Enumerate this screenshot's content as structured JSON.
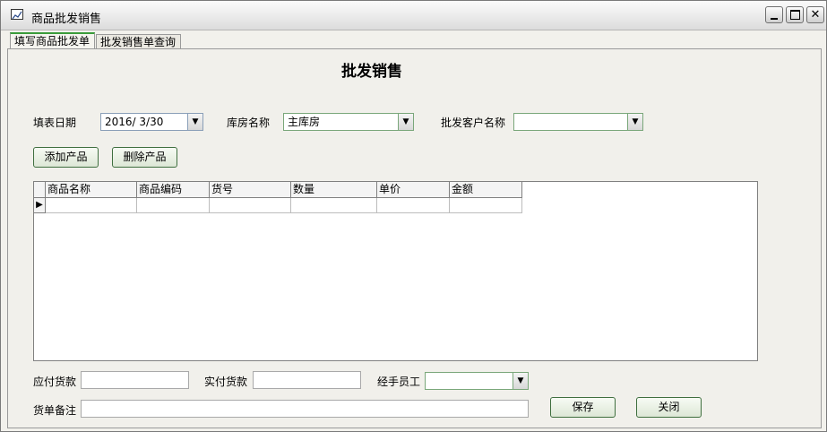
{
  "window": {
    "title": "商品批发销售"
  },
  "tabs": [
    {
      "label": "填写商品批发单",
      "active": true
    },
    {
      "label": "批发销售单查询",
      "active": false
    }
  ],
  "form": {
    "heading": "批发销售",
    "date_label": "填表日期",
    "date_value": "2016/ 3/30",
    "warehouse_label": "库房名称",
    "warehouse_value": "主库房",
    "customer_label": "批发客户名称",
    "customer_value": "",
    "add_product": "添加产品",
    "delete_product": "删除产品"
  },
  "table": {
    "columns": [
      "商品名称",
      "商品编码",
      "货号",
      "数量",
      "单价",
      "金额"
    ],
    "row_indicator": "▶"
  },
  "footer": {
    "payable_label": "应付货款",
    "payable_value": "",
    "paid_label": "实付货款",
    "paid_value": "",
    "handler_label": "经手员工",
    "handler_value": "",
    "remark_label": "货单备注",
    "remark_value": "",
    "save": "保存",
    "close": "关闭"
  },
  "colors": {
    "accent": "#3a9c3a",
    "window_bg": "#f2f1ec"
  }
}
